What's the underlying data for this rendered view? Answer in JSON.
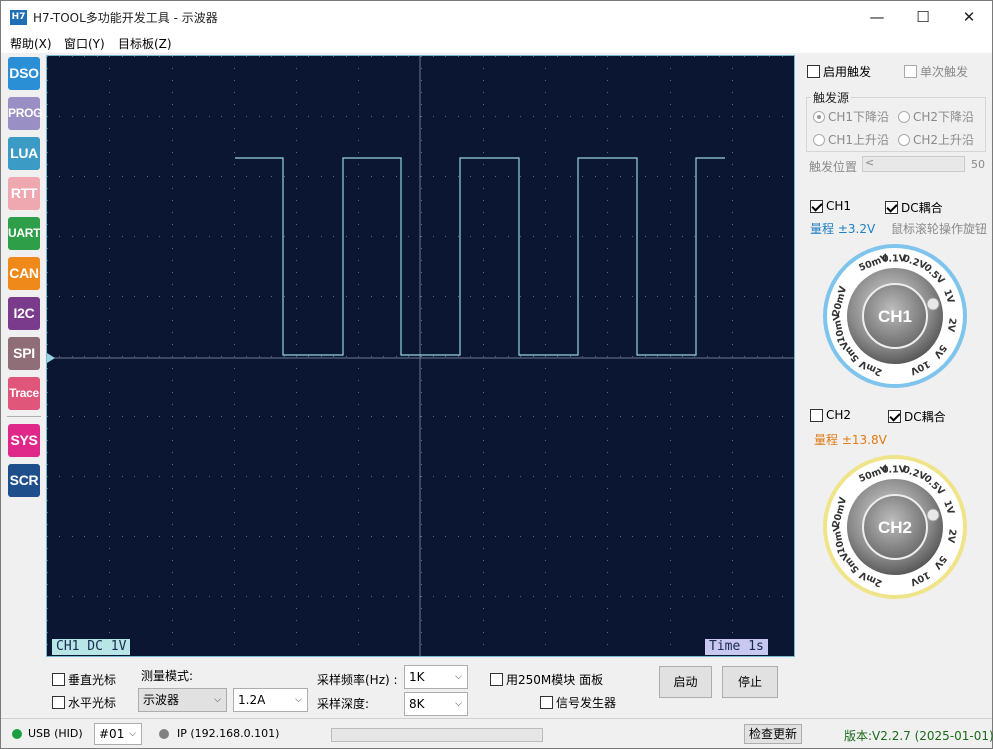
{
  "window": {
    "icon_text": "H7",
    "title": "H7-TOOL多功能开发工具 - 示波器",
    "minimize": "—",
    "maximize": "☐",
    "close": "✕"
  },
  "menu": [
    "帮助(X)",
    "窗口(Y)",
    "目标板(Z)"
  ],
  "tools": [
    {
      "label": "DSO",
      "color": "#2b8fd6"
    },
    {
      "label": "PROG",
      "color": "#9a8fc4"
    },
    {
      "label": "LUA",
      "color": "#3b9bc4"
    },
    {
      "label": "RTT",
      "color": "#f0a8b0"
    },
    {
      "label": "UART",
      "color": "#2f9e48"
    },
    {
      "label": "CAN",
      "color": "#ef8a1a"
    },
    {
      "label": "I2C",
      "color": "#7a3b8c"
    },
    {
      "label": "SPI",
      "color": "#8f6e78"
    },
    {
      "label": "Trace",
      "color": "#e0567a"
    },
    {
      "label": "SYS",
      "color": "#e0288a"
    },
    {
      "label": "SCR",
      "color": "#1e4f8a"
    }
  ],
  "scope": {
    "ch1_label": "CH1 DC   1V",
    "time_label": "Time  1s",
    "trace_color": "#9ad4e4",
    "grid_color": "#5a6a8a",
    "bg_color": "#0a1632"
  },
  "trigger": {
    "enable_label": "启用触发",
    "enable_checked": false,
    "single_label": "单次触发",
    "single_checked": false,
    "source_title": "触发源",
    "options": [
      {
        "label": "CH1下降沿",
        "checked": true
      },
      {
        "label": "CH2下降沿",
        "checked": false
      },
      {
        "label": "CH1上升沿",
        "checked": false
      },
      {
        "label": "CH2上升沿",
        "checked": false
      }
    ],
    "position_label": "触发位置",
    "position_value": "50"
  },
  "ch1": {
    "enable_label": "CH1",
    "enabled": true,
    "dc_label": "DC耦合",
    "dc_checked": true,
    "range_text": "量程 ±3.2V",
    "range_color": "#1e7fc4",
    "hint": "鼠标滚轮操作旋钮",
    "knob_label": "CH1",
    "ring_color": "#7ec4ec",
    "scale": [
      "50mV",
      "0.1V",
      "0.2V",
      "0.5V",
      "1V",
      "2V",
      "5V",
      "10V",
      "2mV",
      "5mV",
      "10mV",
      "20mV"
    ]
  },
  "ch2": {
    "enable_label": "CH2",
    "enabled": false,
    "dc_label": "DC耦合",
    "dc_checked": true,
    "range_text": "量程 ±13.8V",
    "range_color": "#e07a14",
    "knob_label": "CH2",
    "ring_color": "#f0e48a",
    "scale": [
      "50mV",
      "0.1V",
      "0.2V",
      "0.5V",
      "1V",
      "2V",
      "5V",
      "10V",
      "2mV",
      "5mV",
      "10mV",
      "20mV"
    ]
  },
  "bottom": {
    "vcursor_label": "垂直光标",
    "hcursor_label": "水平光标",
    "measure_mode_label": "测量模式:",
    "measure_mode_value": "示波器",
    "current_range_value": "1.2A",
    "sample_rate_label": "采样频率(Hz)  :",
    "sample_rate_value": "1K",
    "sample_depth_label": "采样深度:",
    "sample_depth_value": "8K",
    "module_label": "用250M模块 面板",
    "siggen_label": "信号发生器",
    "start_label": "启动",
    "stop_label": "停止"
  },
  "status": {
    "usb_label": "USB (HID)",
    "usb_color": "#1aa040",
    "device_value": "#01",
    "ip_label": "IP (192.168.0.101)",
    "ip_color": "#808080",
    "update_label": "检查更新",
    "version_label": "版本:V2.2.7 (2025-01-01)",
    "version_color": "#1a6a1a",
    "progress_fraction": 0
  }
}
